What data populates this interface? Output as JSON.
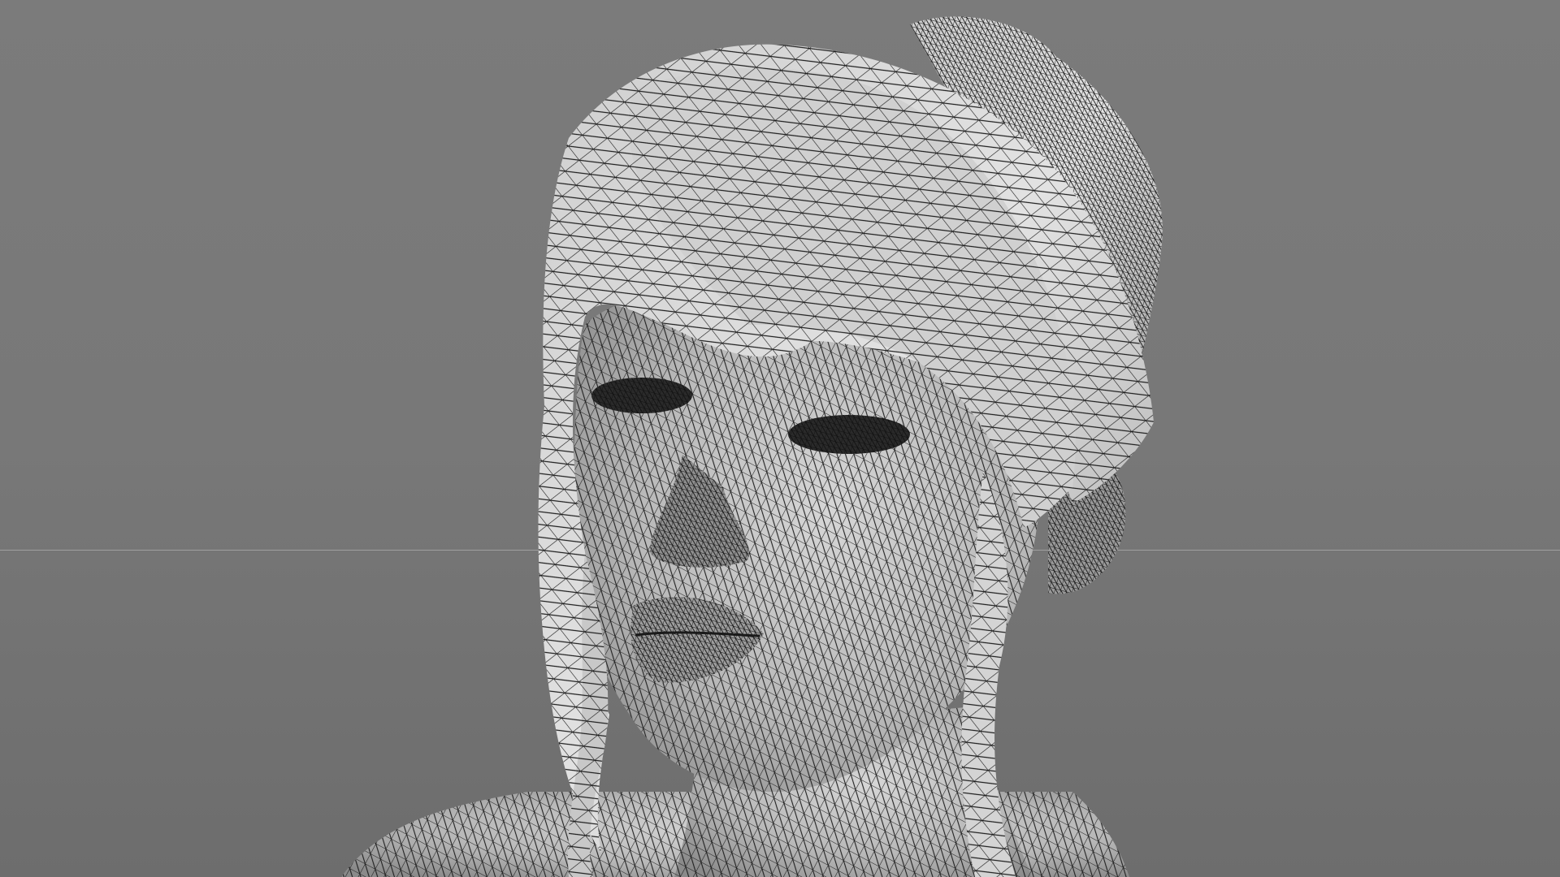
{
  "viewport": {
    "label": "",
    "display_mode": "wireframe-shaded",
    "background_color": "#777777",
    "horizon_color": "#a7a7a7",
    "mesh_surface_color": "#c9c9c9",
    "mesh_wire_color": "#1c1c1c"
  },
  "object": {
    "description_icon": "female-head-mesh-icon"
  }
}
